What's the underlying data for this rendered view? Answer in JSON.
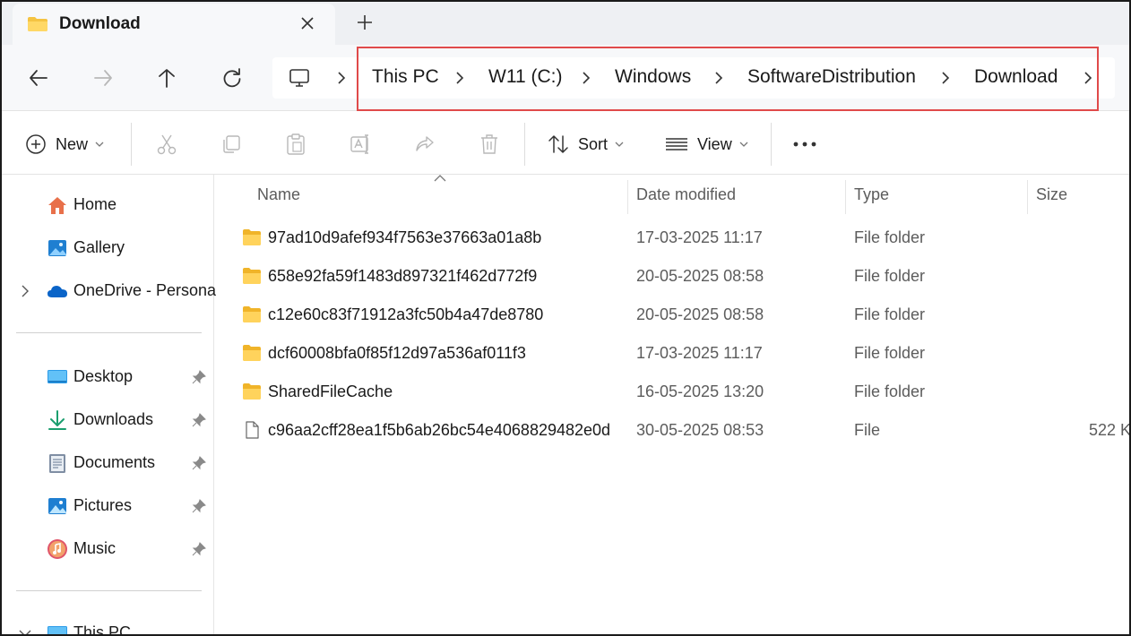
{
  "window": {
    "tab_title": "Download",
    "tab_icon": "folder-icon"
  },
  "address_bar": {
    "breadcrumbs": [
      "This PC",
      "W11 (C:)",
      "Windows",
      "SoftwareDistribution",
      "Download"
    ],
    "highlight_color": "#e04a4a"
  },
  "command_bar": {
    "new_label": "New",
    "sort_label": "Sort",
    "view_label": "View",
    "disabled_actions": [
      "cut-icon",
      "copy-icon",
      "paste-icon",
      "rename-icon",
      "share-icon",
      "delete-icon"
    ]
  },
  "sidebar": {
    "top_items": [
      {
        "label": "Home",
        "icon": "home-icon"
      },
      {
        "label": "Gallery",
        "icon": "gallery-icon"
      },
      {
        "label": "OneDrive - Persona",
        "icon": "onedrive-icon"
      }
    ],
    "pinned_items": [
      {
        "label": "Desktop",
        "icon": "desktop-icon"
      },
      {
        "label": "Downloads",
        "icon": "downloads-icon"
      },
      {
        "label": "Documents",
        "icon": "documents-icon"
      },
      {
        "label": "Pictures",
        "icon": "pictures-icon"
      },
      {
        "label": "Music",
        "icon": "music-icon"
      }
    ],
    "bottom_items": [
      {
        "label": "This PC",
        "icon": "pc-icon"
      }
    ]
  },
  "file_list": {
    "columns": {
      "name": "Name",
      "date": "Date modified",
      "type": "Type",
      "size": "Size"
    },
    "rows": [
      {
        "name": "97ad10d9afef934f7563e37663a01a8b",
        "date": "17-03-2025 11:17",
        "type": "File folder",
        "size": "",
        "icon": "folder-icon"
      },
      {
        "name": "658e92fa59f1483d897321f462d772f9",
        "date": "20-05-2025 08:58",
        "type": "File folder",
        "size": "",
        "icon": "folder-icon"
      },
      {
        "name": "c12e60c83f71912a3fc50b4a47de8780",
        "date": "20-05-2025 08:58",
        "type": "File folder",
        "size": "",
        "icon": "folder-icon"
      },
      {
        "name": "dcf60008bfa0f85f12d97a536af011f3",
        "date": "17-03-2025 11:17",
        "type": "File folder",
        "size": "",
        "icon": "folder-icon"
      },
      {
        "name": "SharedFileCache",
        "date": "16-05-2025 13:20",
        "type": "File folder",
        "size": "",
        "icon": "folder-icon"
      },
      {
        "name": "c96aa2cff28ea1f5b6ab26bc54e4068829482e0d",
        "date": "30-05-2025 08:53",
        "type": "File",
        "size": "522 K",
        "icon": "file-icon"
      }
    ]
  },
  "colors": {
    "folder": "#f5c342",
    "accent": "#0067c0"
  }
}
